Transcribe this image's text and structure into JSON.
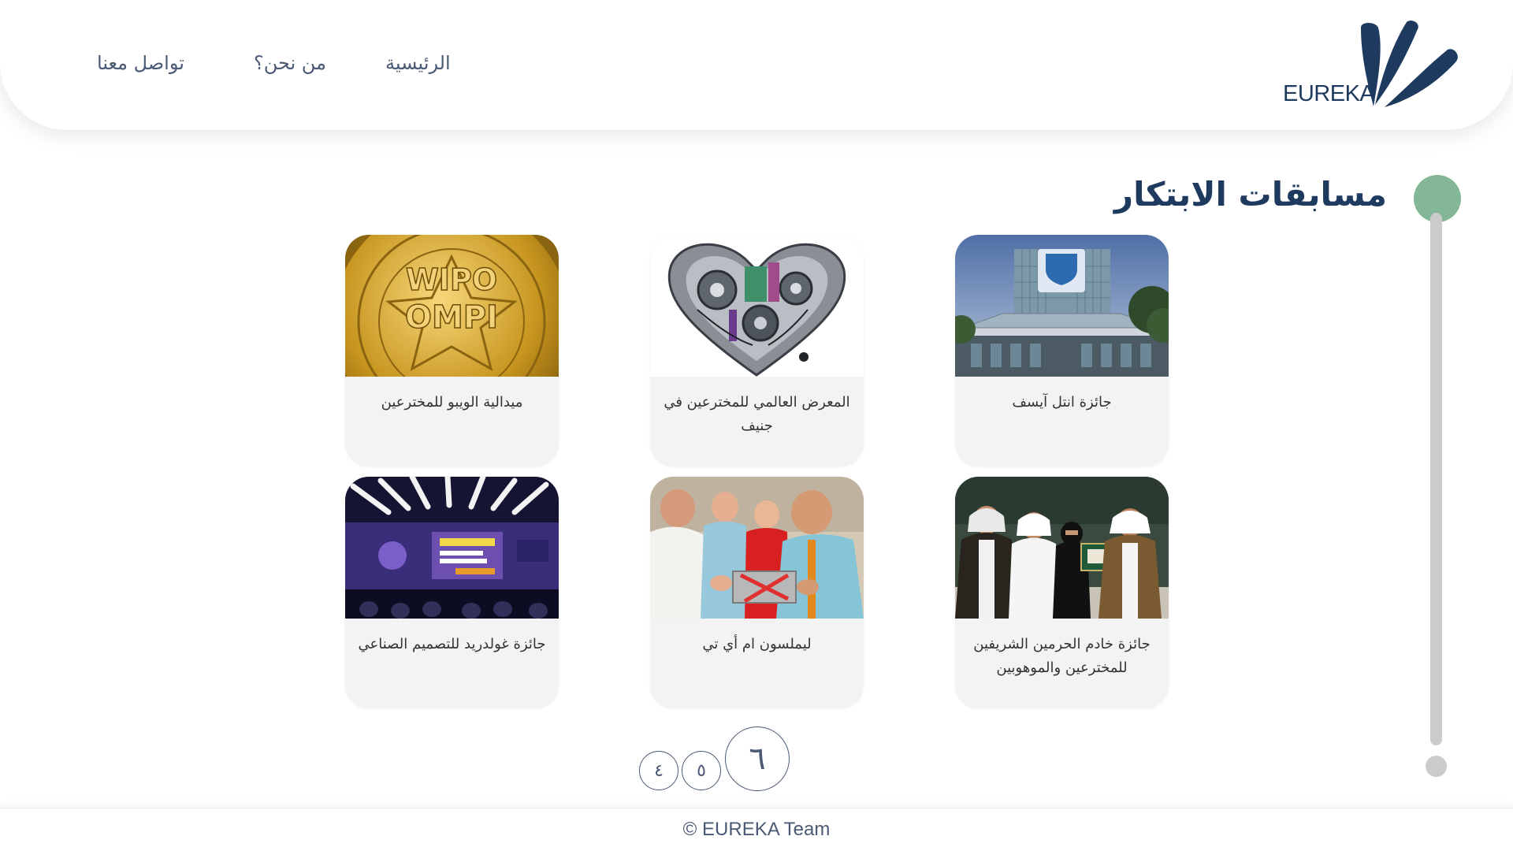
{
  "brand": {
    "logo_text": "EUREKA",
    "color": "#1e3a5f"
  },
  "nav": {
    "home": "الرئيسية",
    "about": "من نحن؟",
    "contact": "تواصل معنا"
  },
  "page": {
    "title": "مسابقات الابتكار"
  },
  "cards": [
    {
      "title": "جائزة انتل آيسف",
      "image": "isef-building-photo"
    },
    {
      "title": "المعرض العالمي للمخترعين في جنيف",
      "image": "mechanical-heart-image"
    },
    {
      "title": "ميدالية الويبو للمخترعين",
      "image": "wipo-gold-medal-photo"
    },
    {
      "title": "جائزة خادم الحرمين الشريفين للمخترعين والموهوبين",
      "image": "award-ceremony-photo"
    },
    {
      "title": "ليملسون ام أي تي",
      "image": "students-workshop-photo"
    },
    {
      "title": "جائزة غولدريد للتصميم الصناعي",
      "image": "design-event-stage-photo"
    }
  ],
  "pagination": {
    "pages": [
      "٤",
      "٥",
      "٦"
    ],
    "current": "٦"
  },
  "footer": {
    "text": "© EUREKA Team"
  },
  "colors": {
    "accent_green": "#84b797",
    "timeline_gray": "#cbcbcb",
    "nav_text": "#4a5a74",
    "card_bg": "#f3f3f3"
  }
}
